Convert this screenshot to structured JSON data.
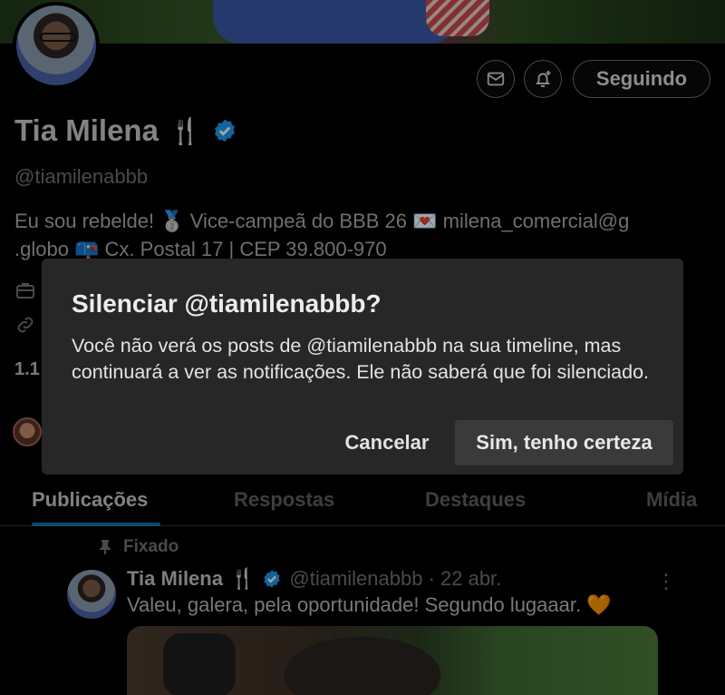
{
  "profile": {
    "name": "Tia Milena",
    "name_emoji": "🍴",
    "handle": "@tiamilenabbb",
    "bio_line1": "Eu sou rebelde!  🥈 Vice-campeã do BBB 26  💌 milena_comercial@g",
    "bio_line2": ".globo  📪 Cx. Postal 17 | CEP 39.800-970",
    "following_label": "Seguindo",
    "stat_partial": "1.1"
  },
  "tabs": [
    "Publicações",
    "Respostas",
    "Destaques",
    "Mídia"
  ],
  "pinned_post": {
    "pinned_label": "Fixado",
    "author": "Tia Milena",
    "author_emoji": "🍴",
    "handle_date": "@tiamilenabbb · 22 abr.",
    "text": "Valeu, galera, pela oportunidade! Segundo lugaaar. 🧡"
  },
  "dialog": {
    "title": "Silenciar @tiamilenabbb?",
    "body": "Você não verá os posts de @tiamilenabbb na sua timeline, mas continuará a ver as notificações. Ele não saberá que foi silenciado.",
    "cancel_label": "Cancelar",
    "confirm_label": "Sim, tenho certeza"
  },
  "colors": {
    "verified": "#1d9bf0",
    "dialog_bg": "#272727",
    "confirm_bg": "#3a3a3a"
  }
}
